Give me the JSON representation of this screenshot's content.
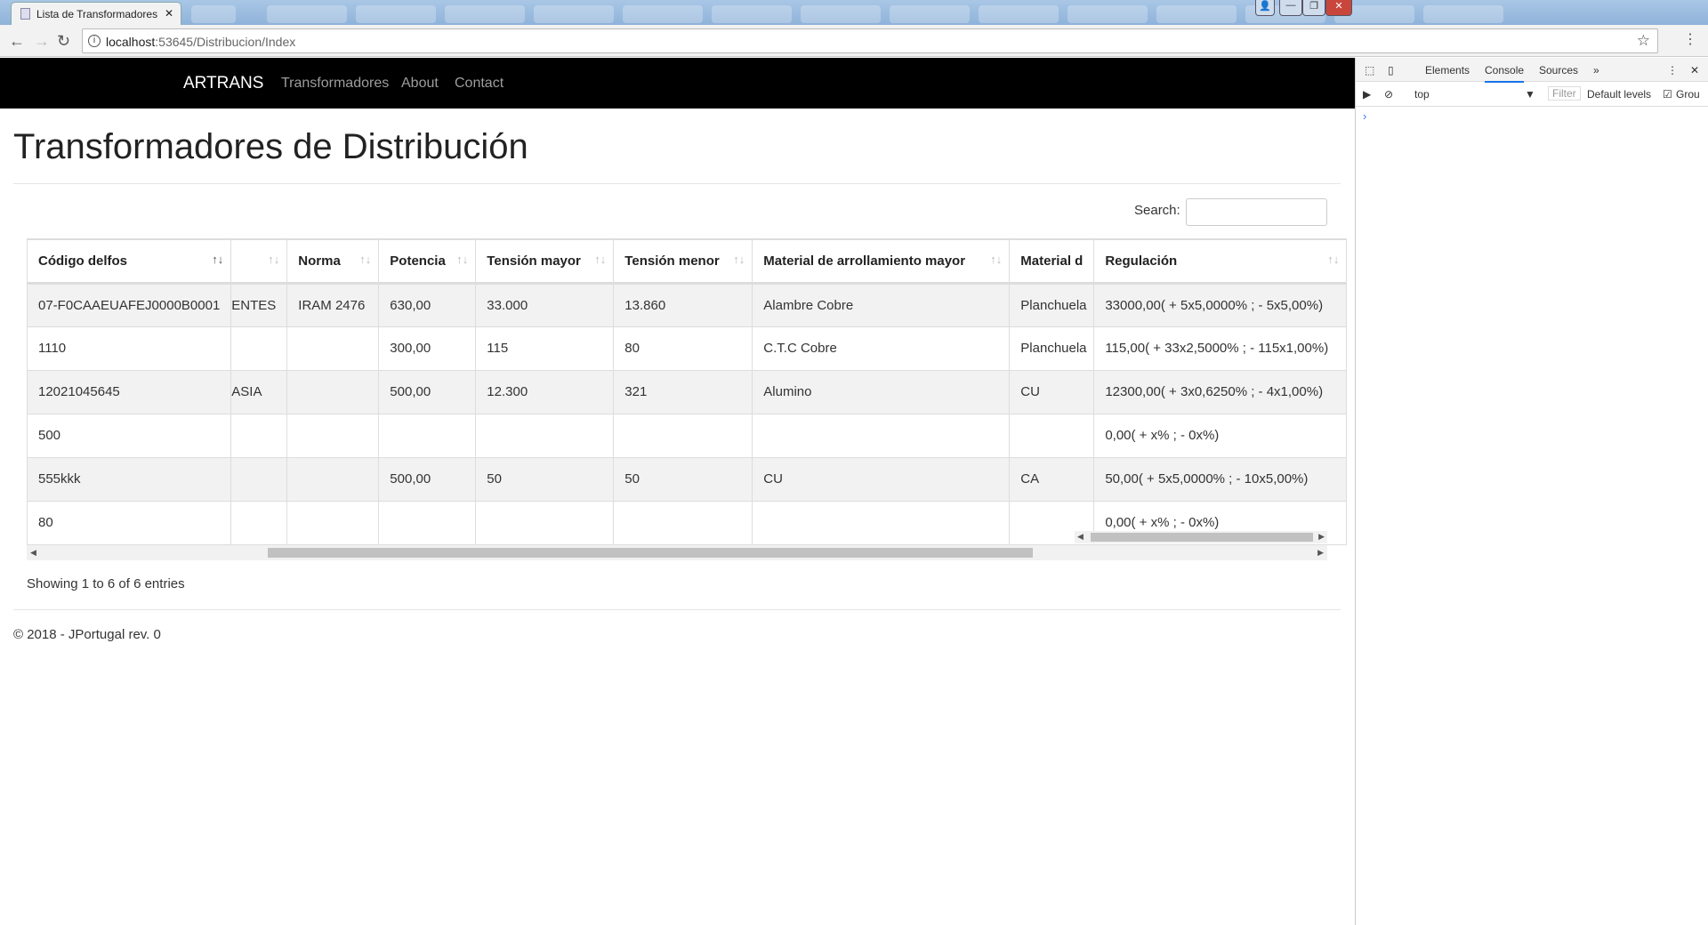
{
  "browser": {
    "tab_title": "Lista de Transformadores",
    "url_host": "localhost",
    "url_rest": ":53645/Distribucion/Index"
  },
  "navbar": {
    "brand": "ARTRANS",
    "links": [
      "Transformadores",
      "About",
      "Contact"
    ]
  },
  "page": {
    "title": "Transformadores de Distribución",
    "search_label": "Search:",
    "search_value": "",
    "info": "Showing 1 to 6 of 6 entries",
    "footer": "© 2018 - JPortugal rev. 0"
  },
  "table": {
    "columns": [
      "Código delfos",
      "",
      "Norma",
      "Potencia",
      "Tensión mayor",
      "Tensión menor",
      "Material de arrollamiento mayor",
      "Material d",
      "Regulación"
    ],
    "sorted_column": "Código delfos",
    "rows": [
      [
        "07-F0CAAEUAFEJ0000B0001",
        "ENTES",
        "IRAM 2476",
        "630,00",
        "33.000",
        "13.860",
        "Alambre Cobre",
        "Planchuela",
        "33000,00( + 5x5,0000% ; - 5x5,00%)"
      ],
      [
        "1110",
        "",
        "",
        "300,00",
        "115",
        "80",
        "C.T.C Cobre",
        "Planchuela",
        "115,00( + 33x2,5000% ; - 115x1,00%)"
      ],
      [
        "12021045645",
        "ASIA",
        "",
        "500,00",
        "12.300",
        "321",
        "Alumino",
        "CU",
        "12300,00( + 3x0,6250% ; - 4x1,00%)"
      ],
      [
        "500",
        "",
        "",
        "",
        "",
        "",
        "",
        "",
        "0,00( + x% ; - 0x%)"
      ],
      [
        "555kkk",
        "",
        "",
        "500,00",
        "50",
        "50",
        "CU",
        "CA",
        "50,00( + 5x5,0000% ; - 10x5,00%)"
      ],
      [
        "80",
        "",
        "",
        "",
        "",
        "",
        "",
        "",
        "0,00( + x% ; - 0x%)"
      ]
    ]
  },
  "devtools": {
    "tabs": [
      "Elements",
      "Console",
      "Sources"
    ],
    "active_tab": "Console",
    "context": "top",
    "filter_placeholder": "Filter",
    "levels": "Default levels",
    "group_label": "Grou"
  }
}
